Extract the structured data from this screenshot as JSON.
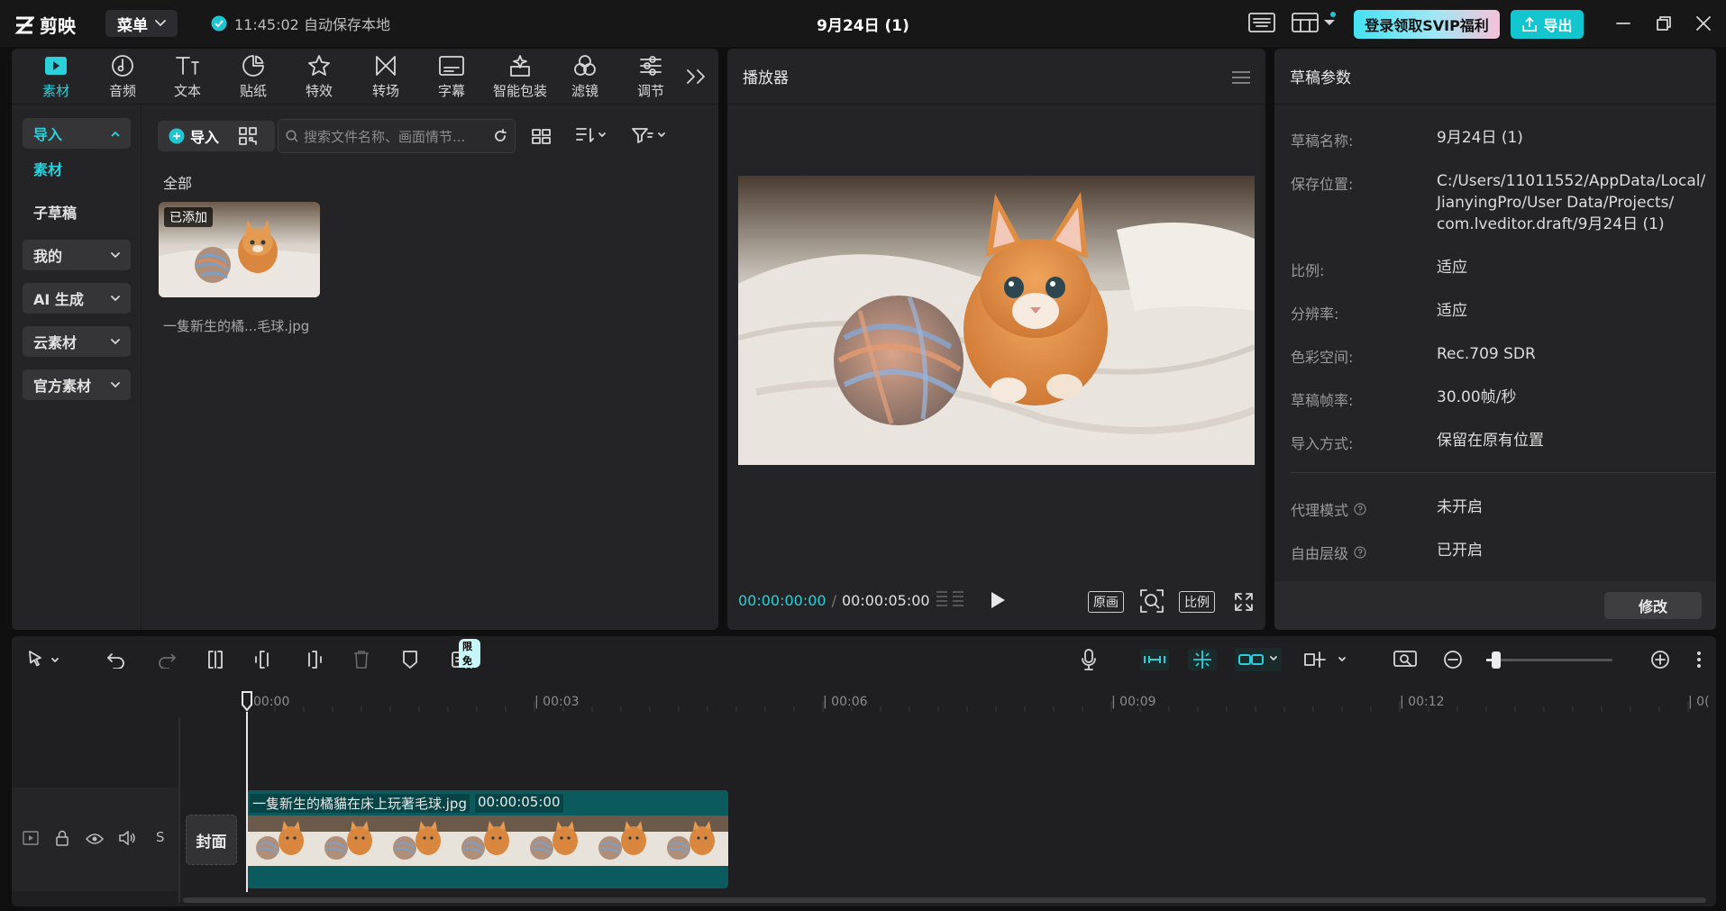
{
  "app": {
    "logo_text": "剪映",
    "menu_label": "菜单",
    "save_status": "11:45:02 自动保存本地",
    "doc_title": "9月24日 (1)",
    "svip_label": "登录领取SVIP福利",
    "export_label": "导出"
  },
  "media_tabs": [
    {
      "label": "素材",
      "icon": "media-icon",
      "active": true
    },
    {
      "label": "音频",
      "icon": "audio-icon"
    },
    {
      "label": "文本",
      "icon": "text-icon"
    },
    {
      "label": "贴纸",
      "icon": "sticker-icon"
    },
    {
      "label": "特效",
      "icon": "effects-icon"
    },
    {
      "label": "转场",
      "icon": "transition-icon"
    },
    {
      "label": "字幕",
      "icon": "caption-icon"
    },
    {
      "label": "智能包装",
      "icon": "smart-pack-icon"
    },
    {
      "label": "滤镜",
      "icon": "filter-icon"
    },
    {
      "label": "调节",
      "icon": "adjust-icon"
    }
  ],
  "sidebar": {
    "import": "导入",
    "media": "素材",
    "sub_draft": "子草稿",
    "mine": "我的",
    "ai": "AI 生成",
    "cloud": "云素材",
    "official": "官方素材"
  },
  "media": {
    "import_label": "导入",
    "search_placeholder": "搜索文件名称、画面情节...",
    "section_all": "全部",
    "item_badge": "已添加",
    "item_name": "一隻新生的橘...毛球.jpg"
  },
  "player": {
    "title": "播放器",
    "current_time": "00:00:00:00",
    "total_time": "00:00:05:00",
    "btn_original": "原画",
    "btn_ratio": "比例"
  },
  "props": {
    "title": "草稿参数",
    "rows": [
      {
        "label": "草稿名称:",
        "value": "9月24日 (1)"
      },
      {
        "label": "保存位置:",
        "value": "C:/Users/11011552/AppData/Local/\nJianyingPro/User Data/Projects/\ncom.lveditor.draft/9月24日 (1)"
      },
      {
        "label": "比例:",
        "value": "适应"
      },
      {
        "label": "分辨率:",
        "value": "适应"
      },
      {
        "label": "色彩空间:",
        "value": "Rec.709 SDR"
      },
      {
        "label": "草稿帧率:",
        "value": "30.00帧/秒"
      },
      {
        "label": "导入方式:",
        "value": "保留在原有位置"
      },
      {
        "label": "代理模式",
        "value": "未开启"
      },
      {
        "label": "自由层级",
        "value": "已开启"
      }
    ],
    "modify_label": "修改"
  },
  "timeline": {
    "free_badge": "限免",
    "ticks": [
      "00:00",
      "| 00:03",
      "| 00:06",
      "| 00:09",
      "| 00:12",
      "| 0("
    ],
    "cover_label": "封面",
    "clip_name": "一隻新生的橘貓在床上玩著毛球.jpg",
    "clip_duration": "00:00:05:00",
    "zoom_level": 0.08
  }
}
